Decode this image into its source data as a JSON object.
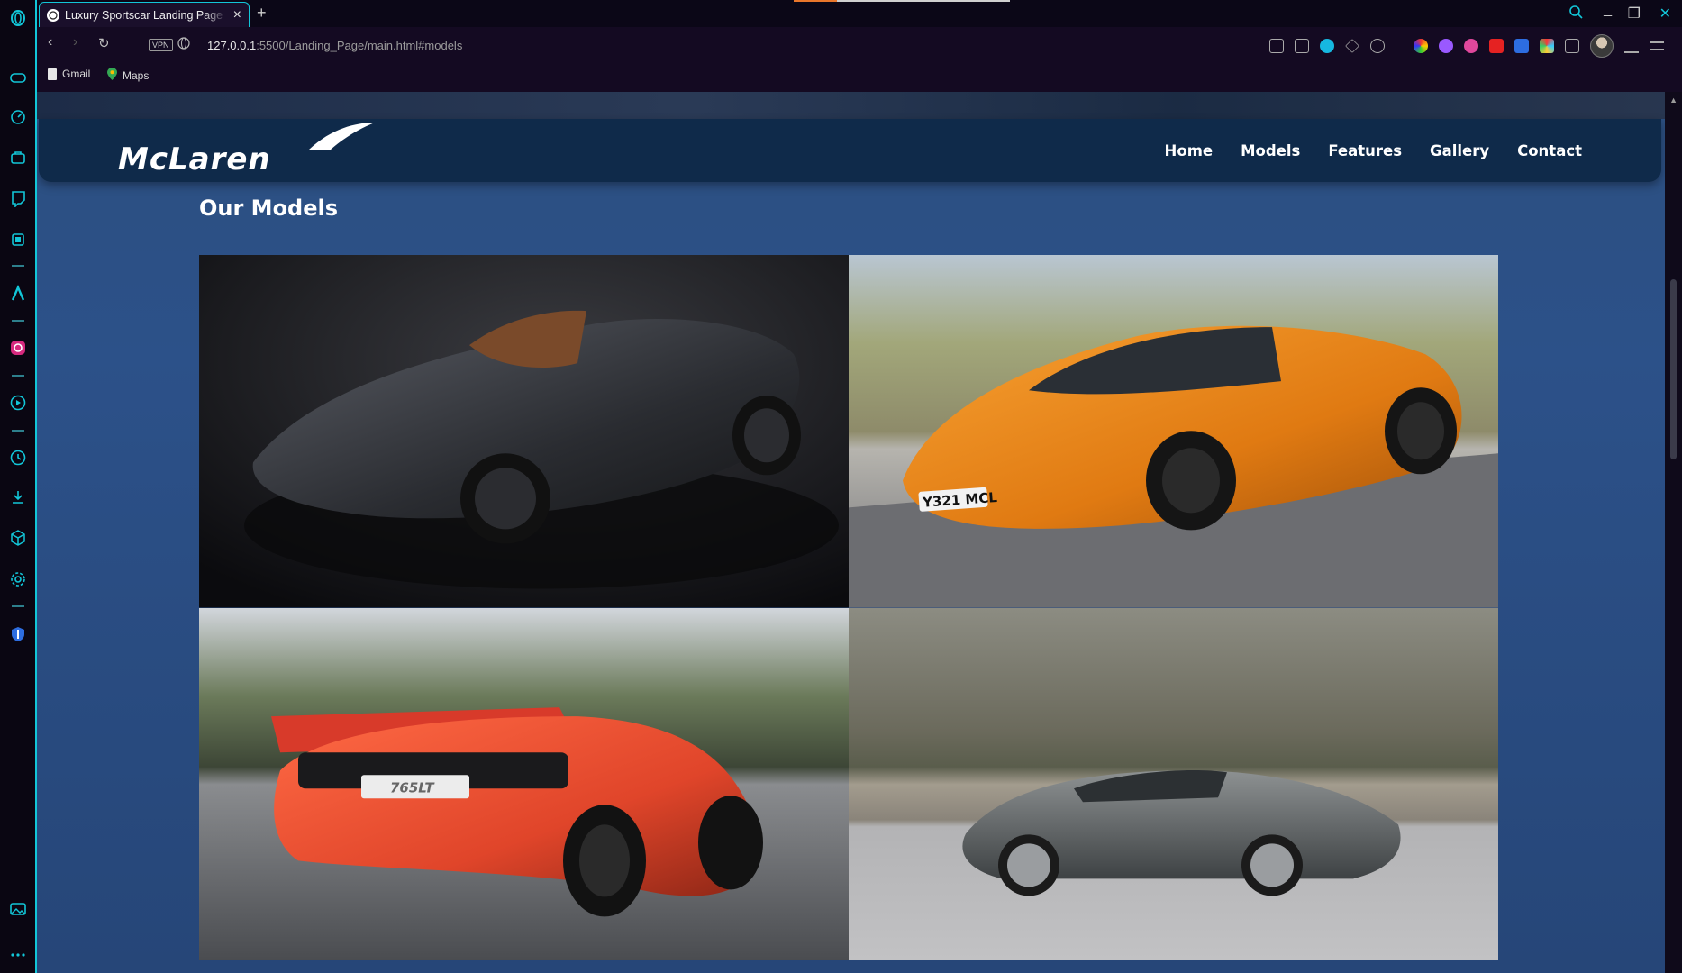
{
  "browser": {
    "tab_title": "Luxury Sportscar Landing Page",
    "url_host": "127.0.0.1",
    "url_rest": ":5500/Landing_Page/main.html#models",
    "vpn_label": "VPN",
    "bookmarks": [
      {
        "label": "Gmail"
      },
      {
        "label": "Maps"
      }
    ]
  },
  "header": {
    "logo_text": "McLaren",
    "nav": [
      {
        "label": "Home"
      },
      {
        "label": "Models"
      },
      {
        "label": "Features"
      },
      {
        "label": "Gallery"
      },
      {
        "label": "Contact"
      }
    ]
  },
  "models": {
    "title": "Our Models",
    "cards": [
      {
        "plate": ""
      },
      {
        "plate": "Y321 MCL"
      },
      {
        "plate": "765LT"
      },
      {
        "plate": ""
      }
    ]
  },
  "colors": {
    "accent": "#12c6d8",
    "header_bg": "#0f2a4a",
    "page_bg": "#2c4f80"
  }
}
